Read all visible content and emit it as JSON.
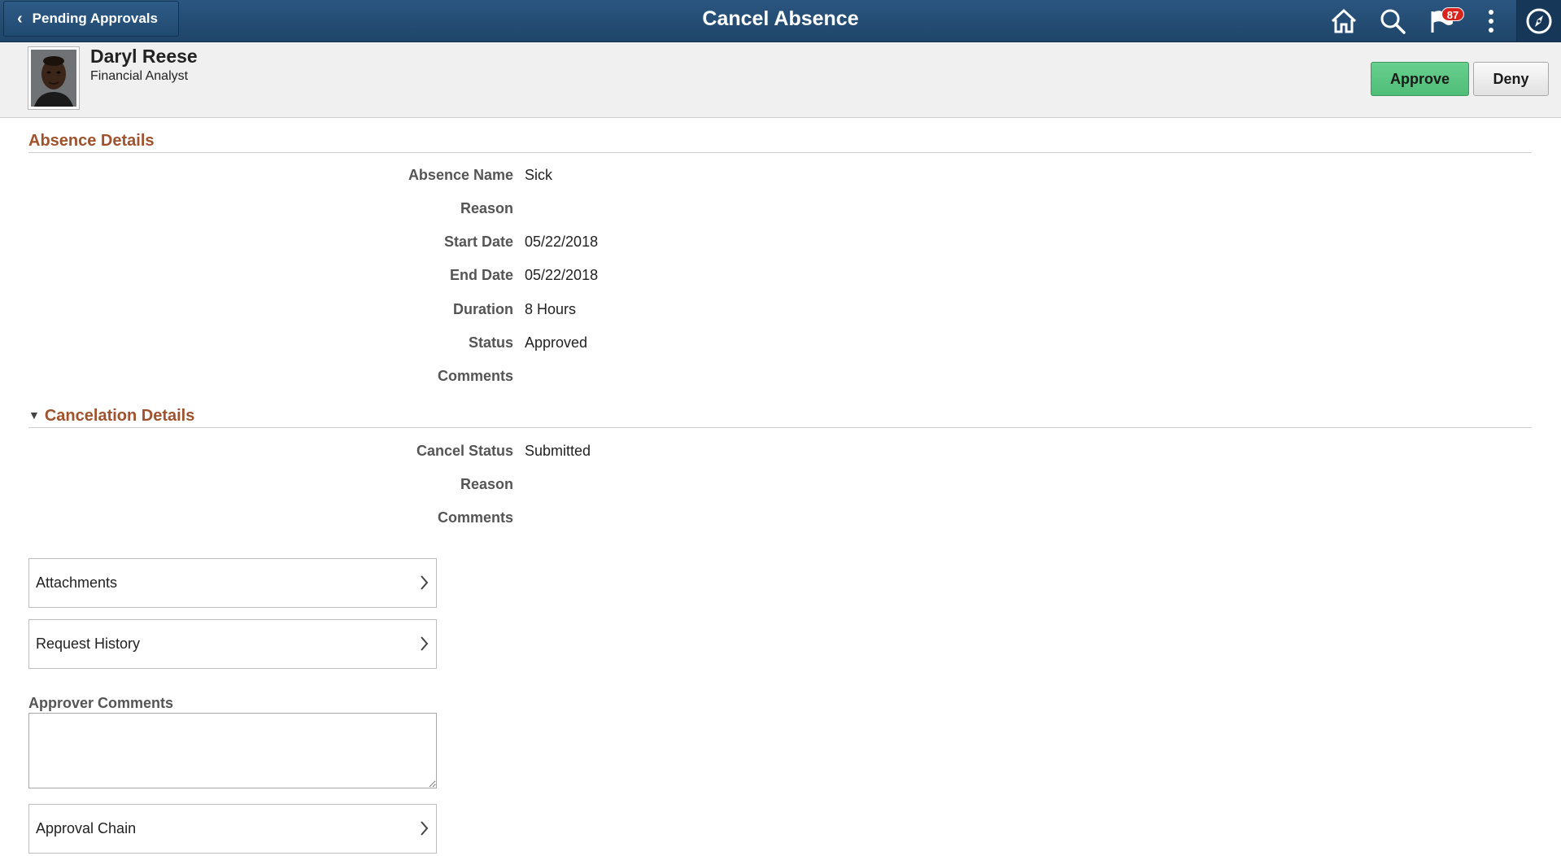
{
  "header": {
    "back_label": "Pending Approvals",
    "title": "Cancel Absence",
    "notification_count": "87",
    "icons": [
      "chevron-left-icon",
      "home-icon",
      "search-icon",
      "notification-flag-icon",
      "actions-menu-icon",
      "navbar-compass-icon"
    ]
  },
  "person": {
    "name": "Daryl Reese",
    "job_title": "Financial Analyst"
  },
  "actions": {
    "approve_label": "Approve",
    "deny_label": "Deny"
  },
  "absence_details": {
    "heading": "Absence Details",
    "fields": [
      {
        "label": "Absence Name",
        "value": "Sick"
      },
      {
        "label": "Reason",
        "value": ""
      },
      {
        "label": "Start Date",
        "value": "05/22/2018"
      },
      {
        "label": "End Date",
        "value": "05/22/2018"
      },
      {
        "label": "Duration",
        "value": "8 Hours"
      },
      {
        "label": "Status",
        "value": "Approved"
      },
      {
        "label": "Comments",
        "value": ""
      }
    ]
  },
  "cancelation_details": {
    "heading": "Cancelation Details",
    "fields": [
      {
        "label": "Cancel Status",
        "value": "Submitted"
      },
      {
        "label": "Reason",
        "value": ""
      },
      {
        "label": "Comments",
        "value": ""
      }
    ]
  },
  "links": {
    "attachments": "Attachments",
    "request_history": "Request History",
    "approval_chain": "Approval Chain"
  },
  "approver_comments": {
    "label": "Approver Comments",
    "value": ""
  },
  "colors": {
    "banner": "#1f4569",
    "section_heading": "#a0522d",
    "approve": "#5ec684",
    "badge": "#d9231f"
  }
}
